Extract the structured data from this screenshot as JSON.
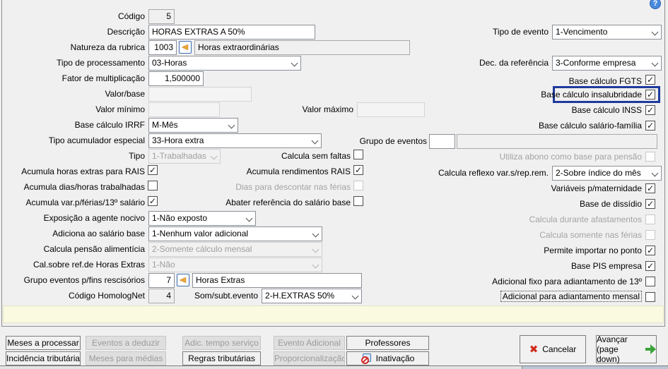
{
  "window": {
    "help_icon": "?"
  },
  "fields": {
    "codigo": {
      "label": "Código",
      "value": "5"
    },
    "descricao": {
      "label": "Descrição",
      "value": "HORAS EXTRAS A 50%"
    },
    "natureza_rubrica": {
      "label": "Natureza da rubrica",
      "code": "1003",
      "description": "Horas extraordinárias"
    },
    "tipo_processamento": {
      "label": "Tipo de processamento",
      "value": "03-Horas"
    },
    "fator_multiplicacao": {
      "label": "Fator de multiplicação",
      "value": "1,500000"
    },
    "valor_base": {
      "label": "Valor/base",
      "value": ""
    },
    "valor_minimo": {
      "label": "Valor mínimo",
      "value": ""
    },
    "valor_maximo": {
      "label": "Valor máximo",
      "value": ""
    },
    "base_calculo_irrf": {
      "label": "Base cálculo IRRF",
      "value": "M-Mês"
    },
    "tipo_acumulador_especial": {
      "label": "Tipo acumulador especial",
      "value": "33-Hora extra"
    },
    "tipo": {
      "label": "Tipo",
      "value": "1-Trabalhadas",
      "enabled": false
    },
    "tipo_evento": {
      "label": "Tipo de evento",
      "value": "1-Vencimento"
    },
    "dec_referencia": {
      "label": "Dec. da referência",
      "value": "3-Conforme empresa"
    },
    "grupo_eventos": {
      "label": "Grupo de eventos",
      "code": "",
      "description": ""
    },
    "calcula_reflexo": {
      "label": "Calcula reflexo var.s/rep.rem.",
      "value": "2-Sobre índice do mês"
    },
    "exposicao_agente_nocivo": {
      "label": "Exposição a agente nocivo",
      "value": "1-Não exposto"
    },
    "adiciona_salario_base": {
      "label": "Adiciona ao salário base",
      "value": "1-Nenhum valor adicional"
    },
    "calcula_pensao": {
      "label": "Calcula pensão alimentícia",
      "value": "2-Somente cálculo mensal",
      "enabled": false
    },
    "cal_sobre_ref_horas_extras": {
      "label": "Cal.sobre ref.de Horas Extras",
      "value": "1-Não",
      "enabled": false
    },
    "grupo_eventos_rescisorios": {
      "label": "Grupo eventos p/fins rescisórios",
      "code": "7",
      "description": "Horas Extras"
    },
    "codigo_homolognet": {
      "label": "Código HomologNet",
      "value": "4"
    },
    "som_subt_evento": {
      "label": "Som/subt.evento",
      "value": "2-H.EXTRAS 50%"
    }
  },
  "checkboxes": {
    "base_calculo_fgts": {
      "label": "Base cálculo FGTS",
      "checked": true
    },
    "base_calculo_insalubridade": {
      "label": "Base cálculo insalubridade",
      "checked": true,
      "highlighted": true
    },
    "base_calculo_inss": {
      "label": "Base cálculo INSS",
      "checked": true
    },
    "base_calculo_salario_familia": {
      "label": "Base cálculo salário-família",
      "checked": true
    },
    "utiliza_abono_pensao": {
      "label": "Utiliza abono como base para pensão",
      "checked": false,
      "enabled": false
    },
    "calcula_sem_faltas": {
      "label": "Calcula sem faltas",
      "checked": false
    },
    "acumula_horas_extras_rais": {
      "label": "Acumula horas extras para RAIS",
      "checked": true
    },
    "acumula_rendimentos_rais": {
      "label": "Acumula rendimentos RAIS",
      "checked": true
    },
    "acumula_dias_horas_trabalhadas": {
      "label": "Acumula dias/horas trabalhadas",
      "checked": false
    },
    "dias_descontar_ferias": {
      "label": "Dias para descontar nas férias",
      "checked": false,
      "enabled": false
    },
    "acumula_var_ferias_13": {
      "label": "Acumula var.p/férias/13º salário",
      "checked": true
    },
    "abater_referencia_salario_base": {
      "label": "Abater referência do salário base",
      "checked": false
    },
    "variaveis_maternidade": {
      "label": "Variáveis p/maternidade",
      "checked": true
    },
    "base_dissidio": {
      "label": "Base de dissídio",
      "checked": true
    },
    "calcula_durante_afastamentos": {
      "label": "Calcula durante afastamentos",
      "checked": false,
      "enabled": false
    },
    "calcula_somente_ferias": {
      "label": "Calcula somente nas férias",
      "checked": false,
      "enabled": false
    },
    "permite_importar_ponto": {
      "label": "Permite importar no ponto",
      "checked": true
    },
    "base_pis_empresa": {
      "label": "Base PIS empresa",
      "checked": true
    },
    "adicional_fixo_13": {
      "label": "Adicional fixo para adiantamento de 13º",
      "checked": false
    },
    "adicional_adiantamento_mensal": {
      "label": "Adicional para adiantamento mensal",
      "checked": false
    }
  },
  "buttons": {
    "meses_a_processar": {
      "label": "Meses a processar",
      "enabled": true
    },
    "eventos_a_deduzir": {
      "label": "Eventos a deduzir",
      "enabled": false
    },
    "adic_tempo_servico": {
      "label": "Adic. tempo serviço",
      "enabled": false
    },
    "evento_adicional": {
      "label": "Evento Adicional",
      "enabled": false
    },
    "professores": {
      "label": "Professores",
      "enabled": true
    },
    "incidencia_tributaria": {
      "label": "Incidência tributária",
      "enabled": true
    },
    "meses_para_medias": {
      "label": "Meses para médias",
      "enabled": false
    },
    "regras_tributarias": {
      "label": "Regras tributárias",
      "enabled": true
    },
    "proporcionalizacao": {
      "label": "Proporcionalização",
      "enabled": false
    },
    "inativacao": {
      "label": "Inativação",
      "enabled": true
    },
    "cancelar": {
      "label": "Cancelar"
    },
    "avancar": {
      "label": "Avançar",
      "sublabel": "(page down)"
    }
  },
  "colors": {
    "highlight_border": "#1e3a9c",
    "notes_background": "#fafae0",
    "cancel_icon": "#cf2a1b",
    "forward_icon": "#3aa33a"
  }
}
